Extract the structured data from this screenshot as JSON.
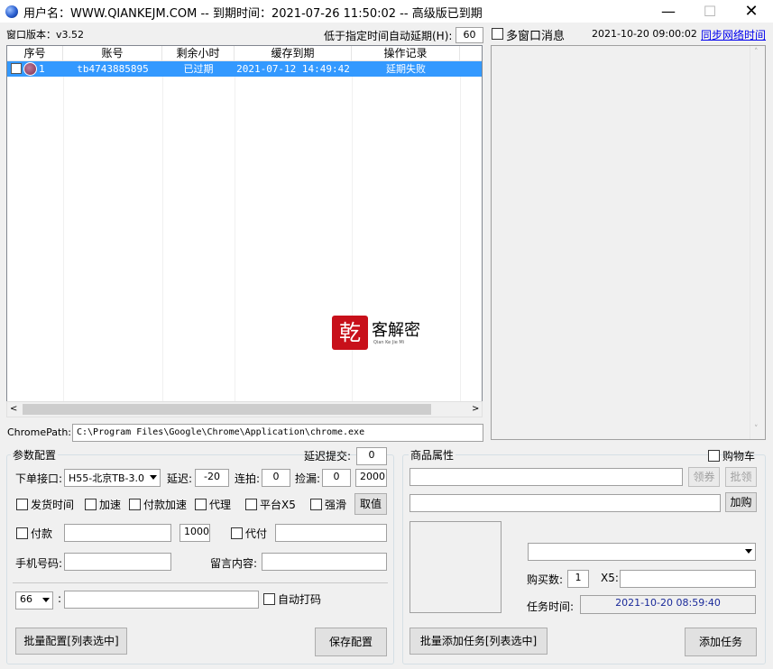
{
  "window": {
    "title": "用户名：WWW.QIANKEJM.COM  --  到期时间：2021-07-26 11:50:02    --      高级版已到期",
    "controls": {
      "minimize": "—",
      "maximize": "☐",
      "close": "✕"
    }
  },
  "top": {
    "version_label": "窗口版本：v3.52",
    "auto_extend_label": "低于指定时间自动延期(H):",
    "auto_extend_value": "60",
    "multi_window_msg_label": "多窗口消息",
    "timestamp": "2021-10-20 09:00:02",
    "sync_link": "同步网络时间"
  },
  "table": {
    "columns": [
      "序号",
      "账号",
      "剩余小时",
      "缓存到期",
      "操作记录"
    ],
    "rows": [
      {
        "index": "1",
        "account": "tb4743885895",
        "remaining": "已过期",
        "cache_expiry": "2021-07-12 14:49:42",
        "log": "延期失败"
      }
    ]
  },
  "watermark": {
    "seal": "乾",
    "text": "客解密",
    "sub": "Qian Ke Jie Mi"
  },
  "chrome_path": {
    "label": "ChromePath:",
    "value": "C:\\Program Files\\Google\\Chrome\\Application\\chrome.exe"
  },
  "params": {
    "title": "参数配置",
    "delay_submit_label": "延迟提交:",
    "delay_submit_value": "0",
    "order_api_label": "下单接口:",
    "order_api_value": "H55-北京TB-3.0",
    "delay_label": "延迟:",
    "delay_value": "-20",
    "combo_label": "连拍:",
    "combo_value": "0",
    "pickup_label": "捡漏:",
    "pickup_value": "0",
    "pickup_extra": "2000",
    "cb_ship_time": "发货时间",
    "cb_accelerate": "加速",
    "cb_pay_accelerate": "付款加速",
    "cb_proxy": "代理",
    "cb_platform_x5": "平台X5",
    "cb_force": "强滑",
    "fetch_button": "取值",
    "cb_pay": "付款",
    "pay_amount": "1000",
    "cb_proxy_pay": "代付",
    "phone_label": "手机号码:",
    "message_label": "留言内容:",
    "select_66": "66",
    "colon": ":",
    "cb_auto_captcha": "自动打码",
    "batch_config_button": "批量配置[列表选中]",
    "save_config_button": "保存配置"
  },
  "product": {
    "title": "商品属性",
    "cb_cart": "购物车",
    "coupon_button": "领券",
    "batch_coupon_button": "批领",
    "add_buy_button": "加购",
    "quantity_label": "购买数:",
    "quantity_value": "1",
    "x5_label": "X5:",
    "task_time_label": "任务时间:",
    "task_time_value": "2021-10-20 08:59:40",
    "batch_add_task_button": "批量添加任务[列表选中]",
    "add_task_button": "添加任务"
  }
}
